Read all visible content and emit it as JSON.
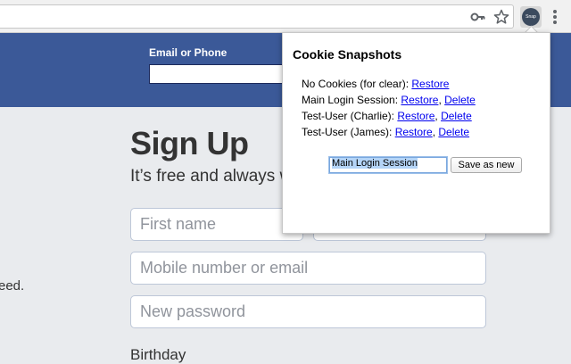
{
  "page": {
    "login_label": "Email or Phone",
    "signup_title": "Sign Up",
    "signup_subtitle": "It’s free and always w",
    "side_text": "eed.",
    "placeholders": {
      "first_name": "First name",
      "mobile": "Mobile number or email",
      "password": "New password"
    },
    "birthday_label": "Birthday"
  },
  "extension": {
    "badge_text": "Snap"
  },
  "popup": {
    "title": "Cookie Snapshots",
    "snapshots": [
      {
        "name": "No Cookies (for clear):",
        "restore": "Restore",
        "delete": ""
      },
      {
        "name": "Main Login Session:",
        "restore": "Restore",
        "delete": "Delete"
      },
      {
        "name": "Test-User (Charlie):",
        "restore": "Restore",
        "delete": "Delete"
      },
      {
        "name": "Test-User (James):",
        "restore": "Restore",
        "delete": "Delete"
      }
    ],
    "name_input_value": "Main Login Session",
    "save_label": "Save as new"
  }
}
